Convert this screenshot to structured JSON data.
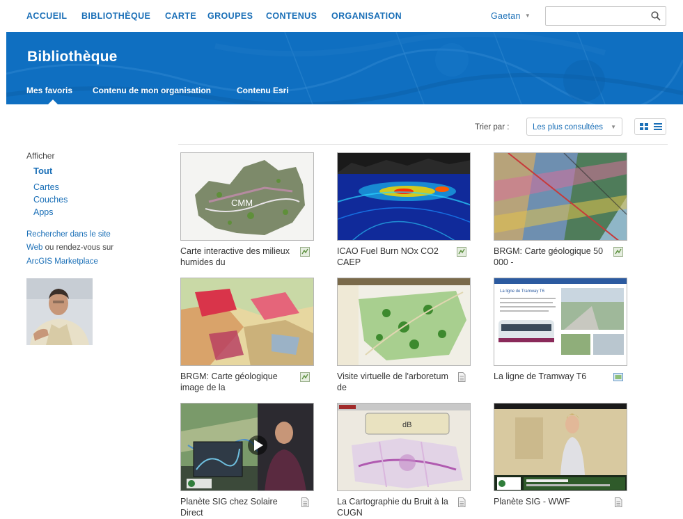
{
  "nav": {
    "items": [
      "ACCUEIL",
      "BIBLIOTHÈQUE",
      "CARTE",
      "GROUPES",
      "CONTENUS",
      "ORGANISATION"
    ],
    "user": "Gaetan",
    "search_value": ""
  },
  "banner": {
    "title": "Bibliothèque",
    "tabs": [
      "Mes favoris",
      "Contenu de mon organisation",
      "Contenu Esri"
    ]
  },
  "sort": {
    "label": "Trier par :",
    "value": "Les plus consultées"
  },
  "sidebar": {
    "heading": "Afficher",
    "filters": [
      "Tout",
      "Cartes",
      "Couches",
      "Apps"
    ],
    "active_filter": "Tout",
    "search_link": "Rechercher dans le site",
    "web_link": "Web",
    "web_suffix": " ou rendez-vous sur",
    "marketplace_link": "ArcGIS Marketplace"
  },
  "items": [
    {
      "title": "Carte interactive des milieux humides du",
      "type_icon": "map-icon",
      "thumb_label": "CMM"
    },
    {
      "title": "ICAO Fuel Burn NOx CO2 CAEP",
      "type_icon": "map-icon",
      "thumb_label": ""
    },
    {
      "title": "BRGM: Carte géologique 50 000 -",
      "type_icon": "map-icon",
      "thumb_label": ""
    },
    {
      "title": "BRGM: Carte géologique image de la",
      "type_icon": "map-icon",
      "thumb_label": ""
    },
    {
      "title": "Visite virtuelle de l'arboretum de",
      "type_icon": "document-icon",
      "thumb_label": ""
    },
    {
      "title": "La ligne de Tramway T6",
      "type_icon": "app-icon",
      "thumb_label": "La ligne de Tramway T6"
    },
    {
      "title": "Planète SIG chez Solaire Direct",
      "type_icon": "document-icon",
      "thumb_label": ""
    },
    {
      "title": "La Cartographie du Bruit à la CUGN",
      "type_icon": "document-icon",
      "thumb_label": "dB"
    },
    {
      "title": "Planète SIG - WWF",
      "type_icon": "document-icon",
      "thumb_label": ""
    }
  ],
  "colors": {
    "brand_blue": "#0f6fc1",
    "link_blue": "#1a6fb7"
  }
}
